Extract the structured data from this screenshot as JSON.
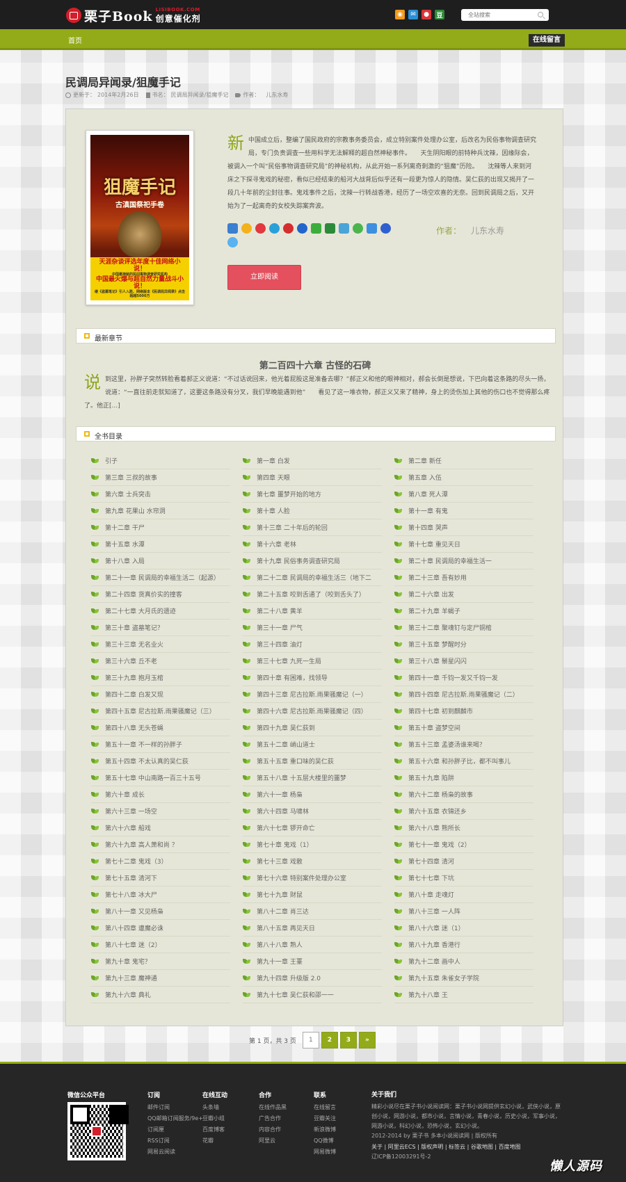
{
  "header": {
    "logo_name": "栗子Book",
    "logo_url": "LISIBOOK.COM",
    "logo_slogan": "创意催化剂",
    "search_placeholder": "全站搜索",
    "social_icons": [
      "rss-icon",
      "mail-icon",
      "weibo-icon",
      "douban-icon"
    ]
  },
  "nav": {
    "home": "首页",
    "guestbook": "在线留言"
  },
  "book": {
    "title": "民调局异闻录/狙魔手记",
    "updated_label": "更新于：",
    "updated": "2014年2月26日",
    "bookname_label": "书名：",
    "bookname": "民调局异闻录/狙魔手记",
    "author_label_meta": "作者：",
    "author": "儿东水寿",
    "intro_dropcap": "新",
    "intro": "中国成立后，整编了国民政府的宗教事务委员会，成立特别案件处理办公室，后改名为民俗事物调查研究局，专门负责调查一些用科学无法解释的超自然神秘事件。　　天生阴阳眼的前特种兵沈辣，因缘际会，被调入一个叫“民俗事物调查研究局”的神秘机构，从此开始一系列离奇刺激的“狙魔”历险。　　沈辣等人来到河床之下探寻鬼戏的秘密，看似已经结束的船河大战背后似乎还有一段更为惊人的隐情。吴仁荻的出现又揭开了一段几十年前的尘封往事。鬼戏事件之后，沈辣一行转战香港，经历了一场空欢喜的无奈。回到民调局之后，又开始为了一起离奇的女校失踪案奔波。",
    "author_label": "作者：",
    "read_button": "立即阅读",
    "cover": {
      "title": "狙魔手记",
      "subtitle": "古滇国祭祀手卷",
      "band_line1": "天涯杂谈评选年度十佳网络小说！",
      "band_line2": "中国最神秘的民间事物调查研究机构",
      "band_line3": "中国最火爆与超自然力量战斗小说！",
      "band_line4": "继《盗墓笔记》引人入胜、网络版本《民调局异闻录》点击超越5000万"
    },
    "share_icons": [
      "add-share-icon",
      "favorite-icon",
      "weibo-icon",
      "pengyou-icon",
      "renren-icon",
      "douban-icon",
      "baidu-icon",
      "wechat-icon",
      "douban-green-icon",
      "qq-icon",
      "clover-icon",
      "baidu-hi-icon",
      "paw-icon",
      "qzone-icon"
    ]
  },
  "latest": {
    "section_label": "最新章节",
    "chapter_title": "第二百四十六章 古怪的石碑",
    "dropcap": "说",
    "excerpt": "到这里，孙胖子突然转脸看着郝正义说道：“不过话说回来，他光着屁股这是准备去哪？”郝正义和他的眼神相对，郝会长倒是想说，下巴向着这条路的尽头一扬，说道：“一直往前走就知道了，这要这条路没有分叉，我们早晚能遇到他”　　看见了这一堆衣物，郝正义又来了精神，身上的烫伤加上其他的伤口也不觉得那么疼了。他正[...]"
  },
  "toc": {
    "section_label": "全书目录",
    "items": [
      "引子",
      "第一章 白发",
      "第二章 新任",
      "第三章 三叔的故事",
      "第四章 天眼",
      "第五章 入伍",
      "第六章 士兵突击",
      "第七章 噩梦开始的地方",
      "第八章 死人潭",
      "第九章 花果山 水帘洞",
      "第十章 人脸",
      "第十一章 有鬼",
      "第十二章 干尸",
      "第十三章 二十年后的轮回",
      "第十四章 哭声",
      "第十五章 水潭",
      "第十六章 老林",
      "第十七章 重见天日",
      "第十八章 入局",
      "第十九章 民俗事务调查研究局",
      "第二十章 民调局的幸福生活一",
      "第二十一章 民调局的幸福生活二（起源）",
      "第二十二章 民调局的幸福生活三（地下二",
      "第二十三章 吾有妙用",
      "第二十四章 货真价实的撞客",
      "第二十五章 咬到舌通了（咬到舌头了）",
      "第二十六章 出发",
      "第二十七章 大月氏的遗迹",
      "第二十八章 黄羊",
      "第二十九章 羊蝎子",
      "第三十章 盗墓笔记？",
      "第三十一章 尸气",
      "第三十二章 聚魂钉与定尸铜棺",
      "第三十三章 无名业火",
      "第三十四章 油灯",
      "第三十五章 梦醒时分",
      "第三十六章 丘不老",
      "第三十七章 九死一生局",
      "第三十八章 鬃星闪闪",
      "第三十九章 抱月玉棺",
      "第四十章 有困难，找领导",
      "第四十一章 千钧一发又千钧一发",
      "第四十二章 白发又现",
      "第四十三章 尼古拉斯.雨果骚魔记（一）",
      "第四十四章 尼古拉斯.雨果骚魔记（二）",
      "第四十五章 尼古拉斯.雨果骚魔记（三）",
      "第四十六章 尼古拉斯.雨果骚魔记（四）",
      "第四十七章 初到麒麟市",
      "第四十八章 无头苍蝇",
      "第四十九章 吴仁荻到",
      "第五十章 盗梦空间",
      "第五十一章 不一样的孙胖子",
      "第五十二章 峭山道士",
      "第五十三章 孟婆汤谁来喝？",
      "第五十四章 不太认真的吴仁荻",
      "第五十五章 重口味的吴仁荻",
      "第五十六章 和孙胖子比，都不叫事儿",
      "第五十七章 中山南路一百三十五号",
      "第五十八章 十五层大楼里的噩梦",
      "第五十九章 陷阱",
      "第六十章 成长",
      "第六十一章 杨枭",
      "第六十二章 杨枭的故事",
      "第六十三章 一场空",
      "第六十四章 马啸林",
      "第六十五章 衣锦还乡",
      "第六十六章 船戏",
      "第六十七章 锣开命亡",
      "第六十八章 熊所长",
      "第六十九章 高人萧和尚 ？",
      "第七十章 鬼戏（1）",
      "第七十一章 鬼戏（2）",
      "第七十二章 鬼戏（3）",
      "第七十三章 戏散",
      "第七十四章 清河",
      "第七十五章 清河下",
      "第七十六章 特别案件处理办公室",
      "第七十七章 下坑",
      "第七十八章 冰大尸",
      "第七十九章 财鼠",
      "第八十章 走魂灯",
      "第八十一章 又见杨枭",
      "第八十二章 肖三达",
      "第八十三章 一人阵",
      "第八十四章 遭魔必诛",
      "第八十五章 再见天日",
      "第八十六章 迷（1）",
      "第八十七章 迷（2）",
      "第八十八章 熟人",
      "第八十九章 香港行",
      "第九十章 鬼宅？",
      "第九十一章 王薹",
      "第九十二章 画中人",
      "第九十三章 魔神通",
      "第九十四章 升级版 2.0",
      "第九十五章 朱雀女子学院",
      "第九十六章 典礼",
      "第九十七章 吴仁荻和邵一一",
      "第九十八章 王"
    ]
  },
  "pager": {
    "text": "第 1 页，共 3 页",
    "pages": [
      "1",
      "2",
      "3",
      "»"
    ]
  },
  "footer": {
    "wechat_title": "微信公众平台",
    "col_subscribe": {
      "title": "订阅",
      "items": [
        "邮件订阅",
        "QQ邮箱订阅服务/9e+",
        "订阅厘",
        "RSS订阅",
        "网易云阅读"
      ]
    },
    "col_interact": {
      "title": "在线互动",
      "items": [
        "头条墙",
        "豆瓣小组",
        "百度博客",
        "花瓣"
      ]
    },
    "col_partner": {
      "title": "合作",
      "items": [
        "在线作品黑",
        "广告合作",
        "内容合作",
        "阿里云"
      ]
    },
    "col_contact": {
      "title": "联系",
      "items": [
        "在线留言",
        "豆瓣关注",
        "新浪微博",
        "QQ微博",
        "网易微博"
      ]
    },
    "about_title": "关于我们",
    "about_text": "精彩小说尽在栗子书小说阅读网：栗子书小说网提供玄幻小说，武侠小说，原创小说，网游小说，都市小说，言情小说，青春小说，历史小说，军事小说，网游小说，科幻小说，恐怖小说，玄幻小说。",
    "copyright": "2012-2014 by 栗子书 多本小说阅读网 | 版权所有",
    "links": "关于 | 阿里云ECS | 版权声明 | 标签云 | 谷歌地图 | 百度地图",
    "icp": "辽ICP备12003291号-2"
  },
  "watermark": "懒人源码",
  "colors": {
    "accent": "#93ab18",
    "topbar": "#1e1e1e",
    "read_button": "#e4505d",
    "footer": "#262626"
  }
}
